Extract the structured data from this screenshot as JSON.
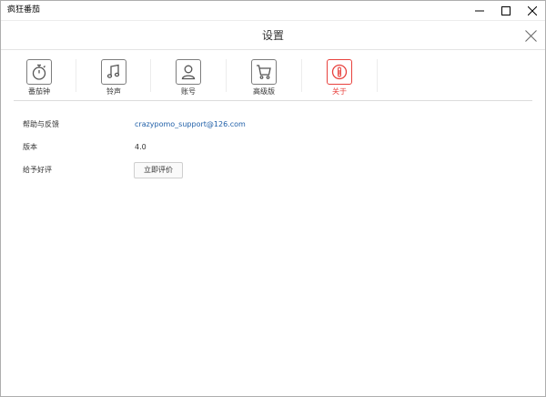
{
  "window": {
    "title": "疯狂番茄",
    "controls": {
      "minimize_icon": "minimize-icon",
      "maximize_icon": "maximize-icon",
      "close_icon": "close-icon"
    }
  },
  "header": {
    "title": "设置",
    "close_icon": "close-icon"
  },
  "tabs": [
    {
      "label": "番茄钟",
      "icon": "stopwatch-icon",
      "active": false
    },
    {
      "label": "铃声",
      "icon": "music-note-icon",
      "active": false
    },
    {
      "label": "账号",
      "icon": "user-icon",
      "active": false
    },
    {
      "label": "高级版",
      "icon": "shopping-cart-icon",
      "active": false
    },
    {
      "label": "关于",
      "icon": "info-icon",
      "active": true
    }
  ],
  "colors": {
    "accent": "#e8413d",
    "link": "#1f5fa8",
    "text": "#333333"
  },
  "about": {
    "help_label": "帮助与反馈",
    "help_email": "crazypomo_support@126.com",
    "version_label": "版本",
    "version_value": "4.0",
    "rate_label": "给予好评",
    "rate_button": "立即评价"
  }
}
